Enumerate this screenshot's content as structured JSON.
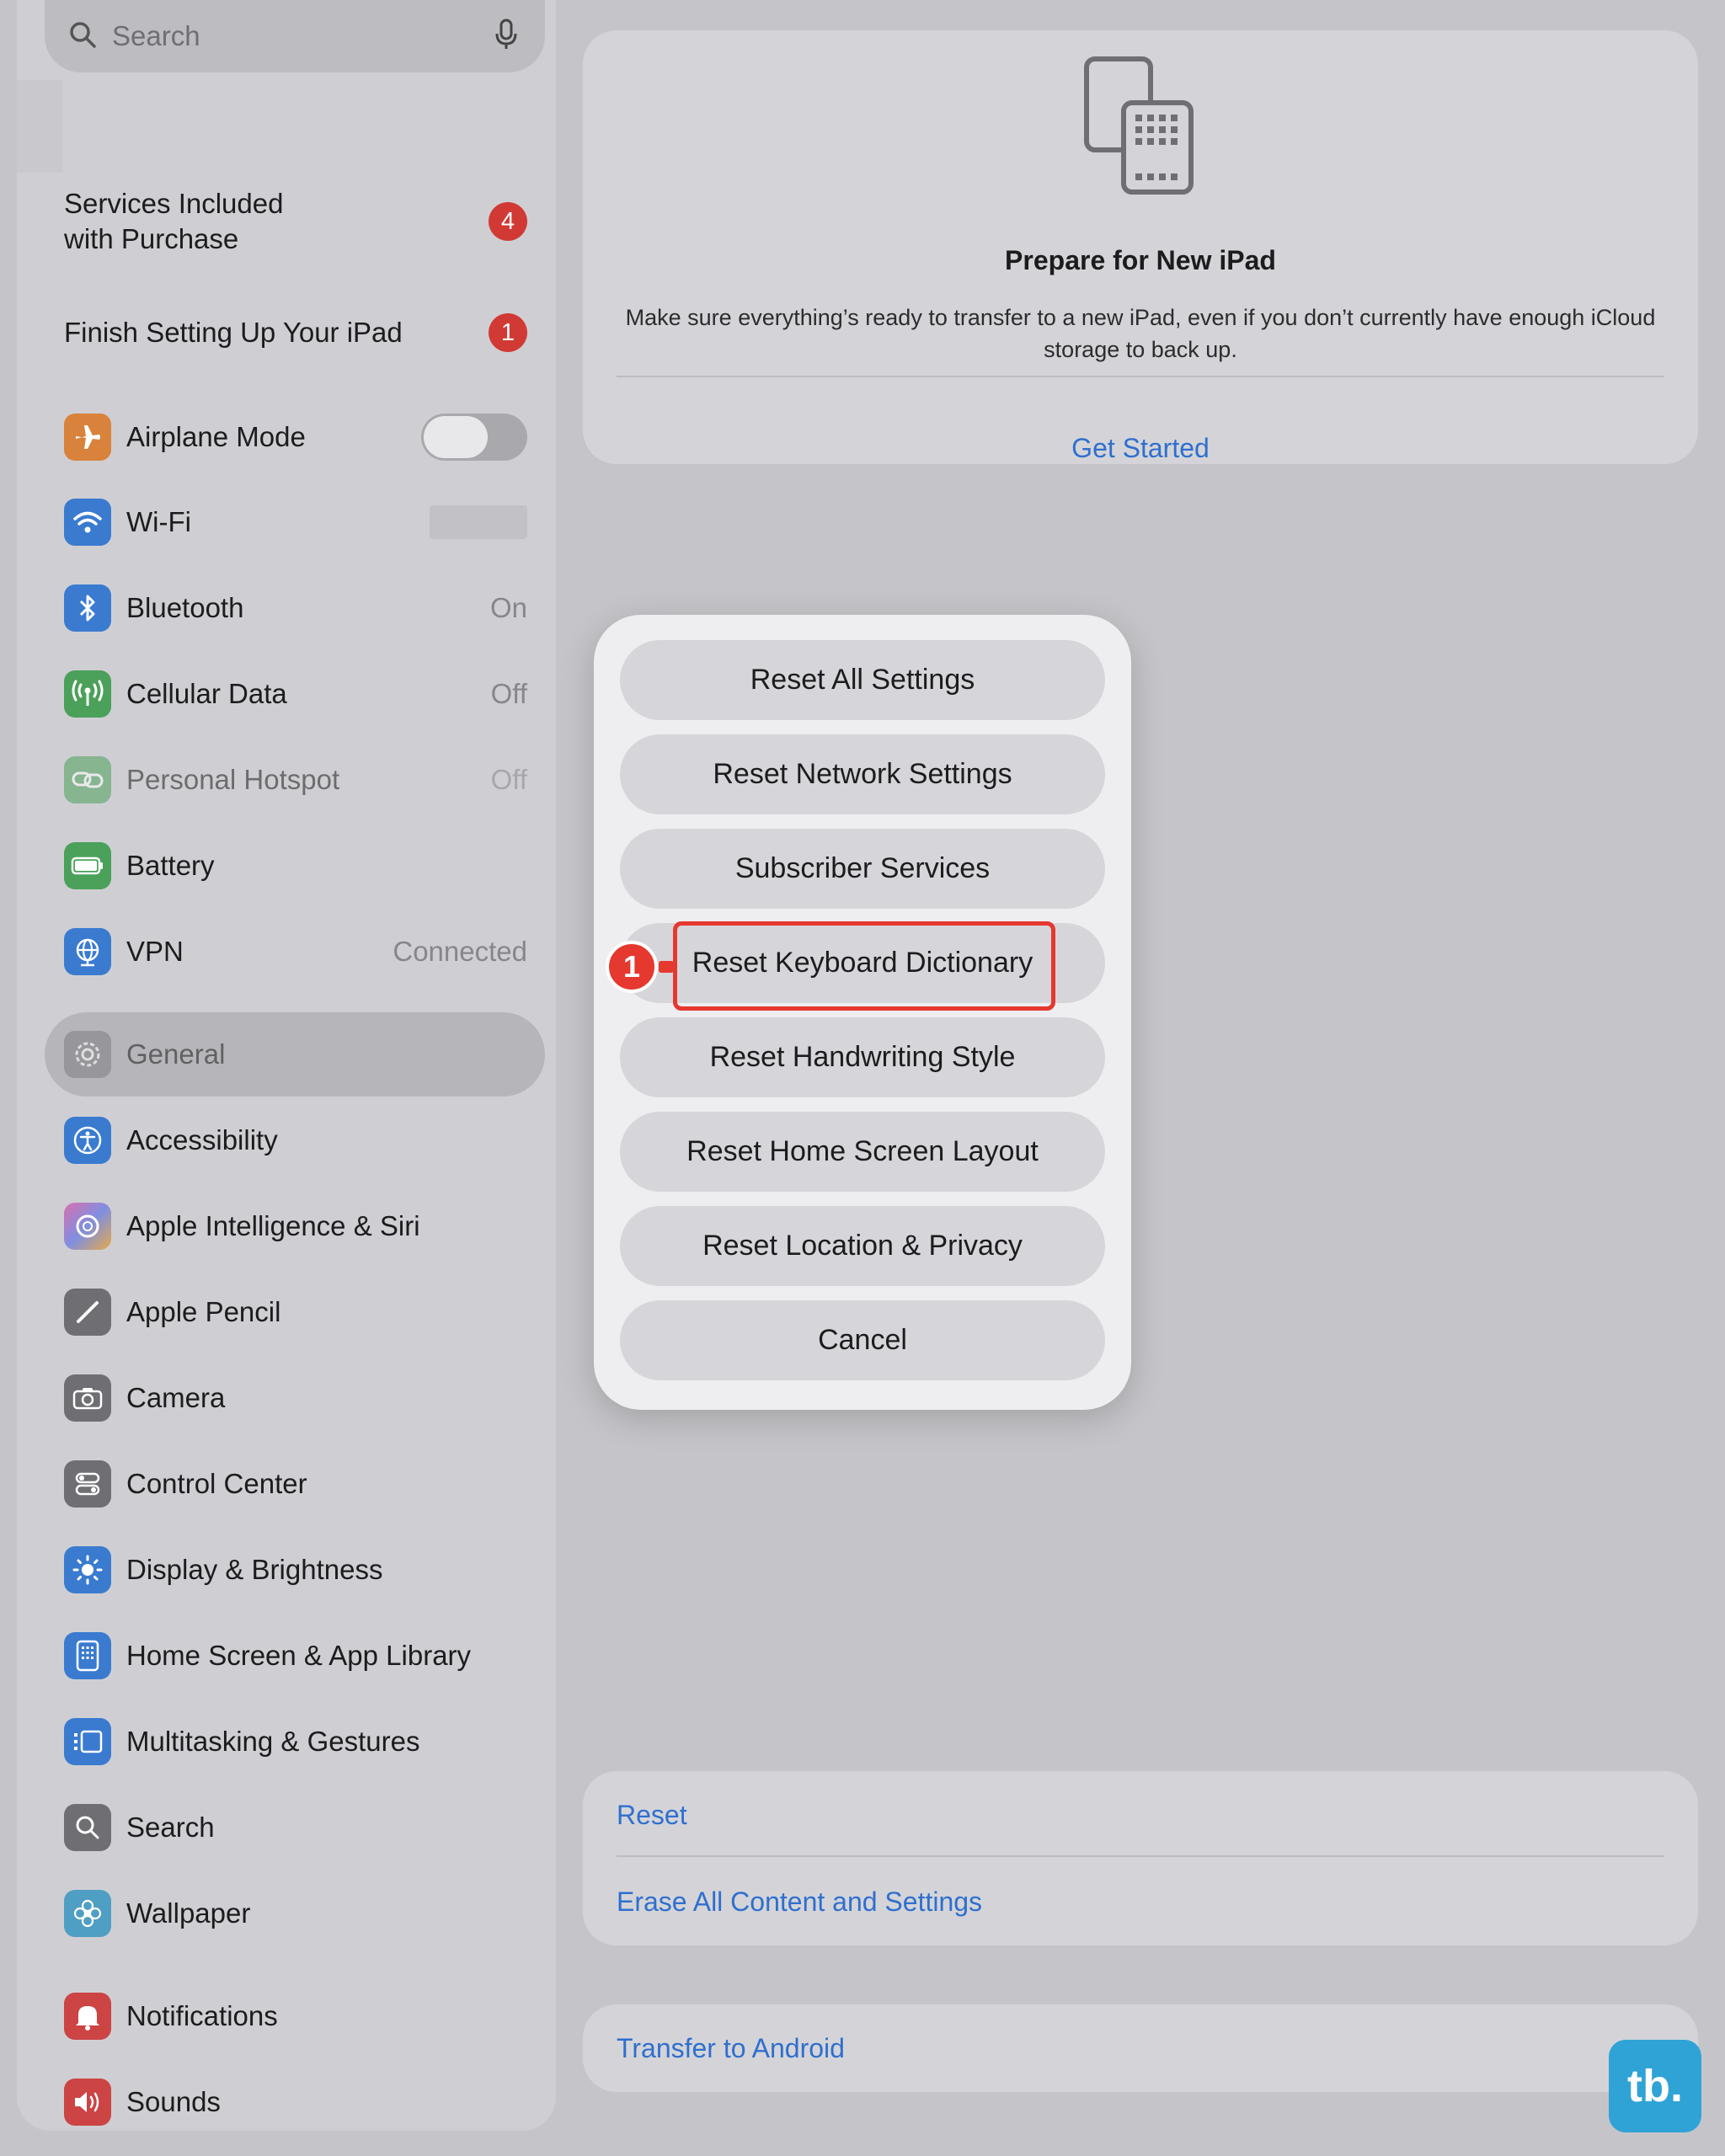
{
  "sidebar": {
    "search_placeholder": "Search",
    "services_label": "Services Included with Purchase",
    "services_line1": "Services Included",
    "services_line2": "with Purchase",
    "services_badge": "4",
    "finish_label": "Finish Setting Up Your iPad",
    "finish_badge": "1",
    "airplane": "Airplane Mode",
    "wifi": "Wi-Fi",
    "bluetooth": "Bluetooth",
    "bluetooth_value": "On",
    "cellular": "Cellular Data",
    "cellular_value": "Off",
    "hotspot": "Personal Hotspot",
    "hotspot_value": "Off",
    "battery": "Battery",
    "vpn": "VPN",
    "vpn_value": "Connected",
    "general": "General",
    "accessibility": "Accessibility",
    "siri": "Apple Intelligence & Siri",
    "pencil": "Apple Pencil",
    "camera": "Camera",
    "control_center": "Control Center",
    "display": "Display & Brightness",
    "home_screen": "Home Screen & App Library",
    "multitasking": "Multitasking & Gestures",
    "search": "Search",
    "wallpaper": "Wallpaper",
    "notifications": "Notifications",
    "sounds": "Sounds"
  },
  "prepare": {
    "title": "Prepare for New iPad",
    "description": "Make sure everything’s ready to transfer to a new iPad, even if you don’t currently have enough iCloud storage to back up.",
    "link": "Get Started"
  },
  "reset_section": {
    "reset": "Reset",
    "erase": "Erase All Content and Settings",
    "transfer": "Transfer to Android"
  },
  "action_sheet": {
    "buttons": [
      "Reset All Settings",
      "Reset Network Settings",
      "Subscriber Services",
      "Reset Keyboard Dictionary",
      "Reset Handwriting Style",
      "Reset Home Screen Layout",
      "Reset Location & Privacy",
      "Cancel"
    ]
  },
  "annotation": {
    "step": "1"
  },
  "watermark": "tb.",
  "colors": {
    "accent_link": "#2f6fce",
    "annotation_red": "#e5382f",
    "badge_red": "#d13a34"
  }
}
